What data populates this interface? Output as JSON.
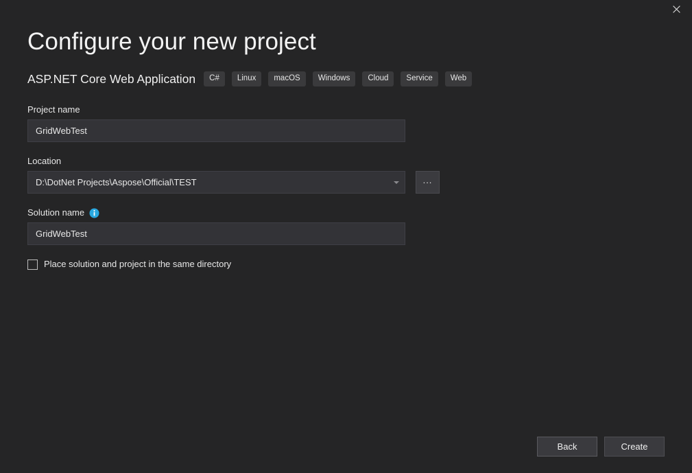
{
  "window": {
    "close_icon": "close-icon"
  },
  "header": {
    "title": "Configure your new project",
    "template_name": "ASP.NET Core Web Application",
    "tags": [
      {
        "label": "C#"
      },
      {
        "label": "Linux"
      },
      {
        "label": "macOS"
      },
      {
        "label": "Windows"
      },
      {
        "label": "Cloud"
      },
      {
        "label": "Service"
      },
      {
        "label": "Web"
      }
    ]
  },
  "form": {
    "project_name": {
      "label": "Project name",
      "value": "GridWebTest",
      "placeholder": ""
    },
    "location": {
      "label": "Location",
      "value": "D:\\DotNet Projects\\Aspose\\Official\\TEST",
      "placeholder": "",
      "dropdown_icon": "chevron-down-icon",
      "browse_label": "..."
    },
    "solution_name": {
      "label": "Solution name",
      "value": "GridWebTest",
      "placeholder": "",
      "info_icon": "info-icon"
    },
    "same_directory": {
      "label": "Place solution and project in the same directory",
      "checked": false
    }
  },
  "footer": {
    "back_label": "Back",
    "create_label": "Create"
  },
  "colors": {
    "background": "#252526",
    "input_background": "#333337",
    "pill_background": "#3a3a3c",
    "info_blue": "#29a8e0",
    "text": "#f0f0f0"
  }
}
